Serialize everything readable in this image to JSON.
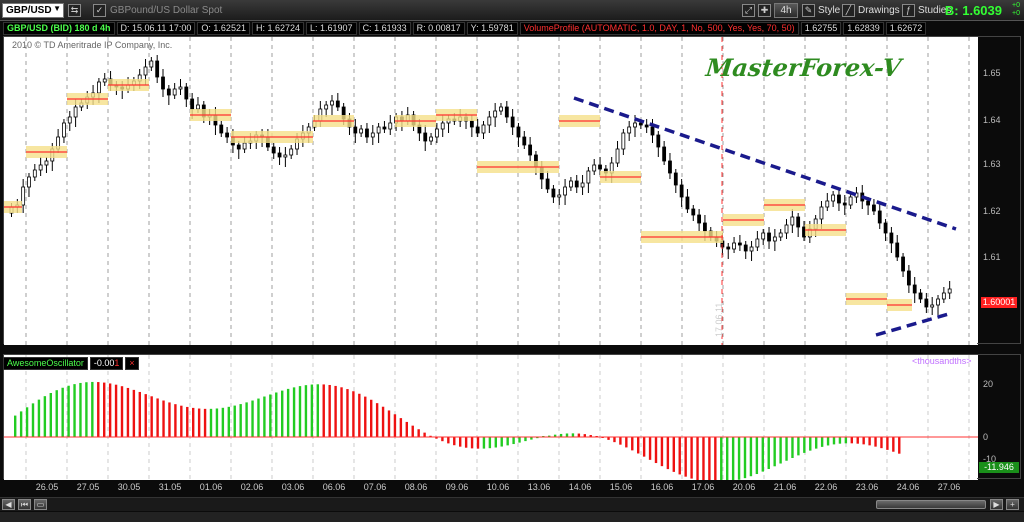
{
  "toolbar": {
    "symbol": "GBP/USD",
    "description": "GBPound/US Dollar Spot",
    "timeframe": "4h",
    "style_label": "Style",
    "drawings_label": "Drawings",
    "studies_label": "Studies",
    "bid": "B: 1.6039",
    "change_plus": "+0",
    "change_val": "+0"
  },
  "info": {
    "title": "GBP/USD (BID) 180 d 4h",
    "date": "D: 15.06.11 17:00",
    "open": "O: 1.62521",
    "high": "H: 1.62724",
    "low": "L: 1.61907",
    "close": "C: 1.61933",
    "range": "R: 0.00817",
    "y": "Y: 1.59781",
    "volume_profile": "VolumeProfile (AUTOMATIC, 1.0, DAY, 1, No, 500, Yes, Yes, 70, 50)",
    "vp1": "1.62755",
    "vp2": "1.62839",
    "vp3": "1.62672"
  },
  "copyright": "2010 © TD Ameritrade IP Company, Inc.",
  "watermark": "MasterForex-V",
  "vertical_label": "17.06.11",
  "price_axis": {
    "ticks": [
      "1.65",
      "1.64",
      "1.63",
      "1.62",
      "1.61"
    ],
    "current_price": "1.60001"
  },
  "oscillator": {
    "name": "AwesomeOscillator",
    "value": "-0.00",
    "value_suffix": "1",
    "close_label": "×",
    "unit": "<thousandths>",
    "ticks": [
      "20",
      "0",
      "-10"
    ],
    "current_value": "-11.946"
  },
  "dates": [
    "26.05",
    "27.05",
    "30.05",
    "31.05",
    "01.06",
    "02.06",
    "03.06",
    "06.06",
    "07.06",
    "08.06",
    "09.06",
    "10.06",
    "13.06",
    "14.06",
    "15.06",
    "16.06",
    "17.06",
    "20.06",
    "21.06",
    "22.06",
    "23.06",
    "24.06",
    "27.06"
  ],
  "colors": {
    "bull_bar": "#22cc22",
    "bear_bar": "#ee1111",
    "trendline": "#1a1a8c",
    "candle": "#000000",
    "value_area": "#f5e08a",
    "poc": "#ff3030"
  }
}
